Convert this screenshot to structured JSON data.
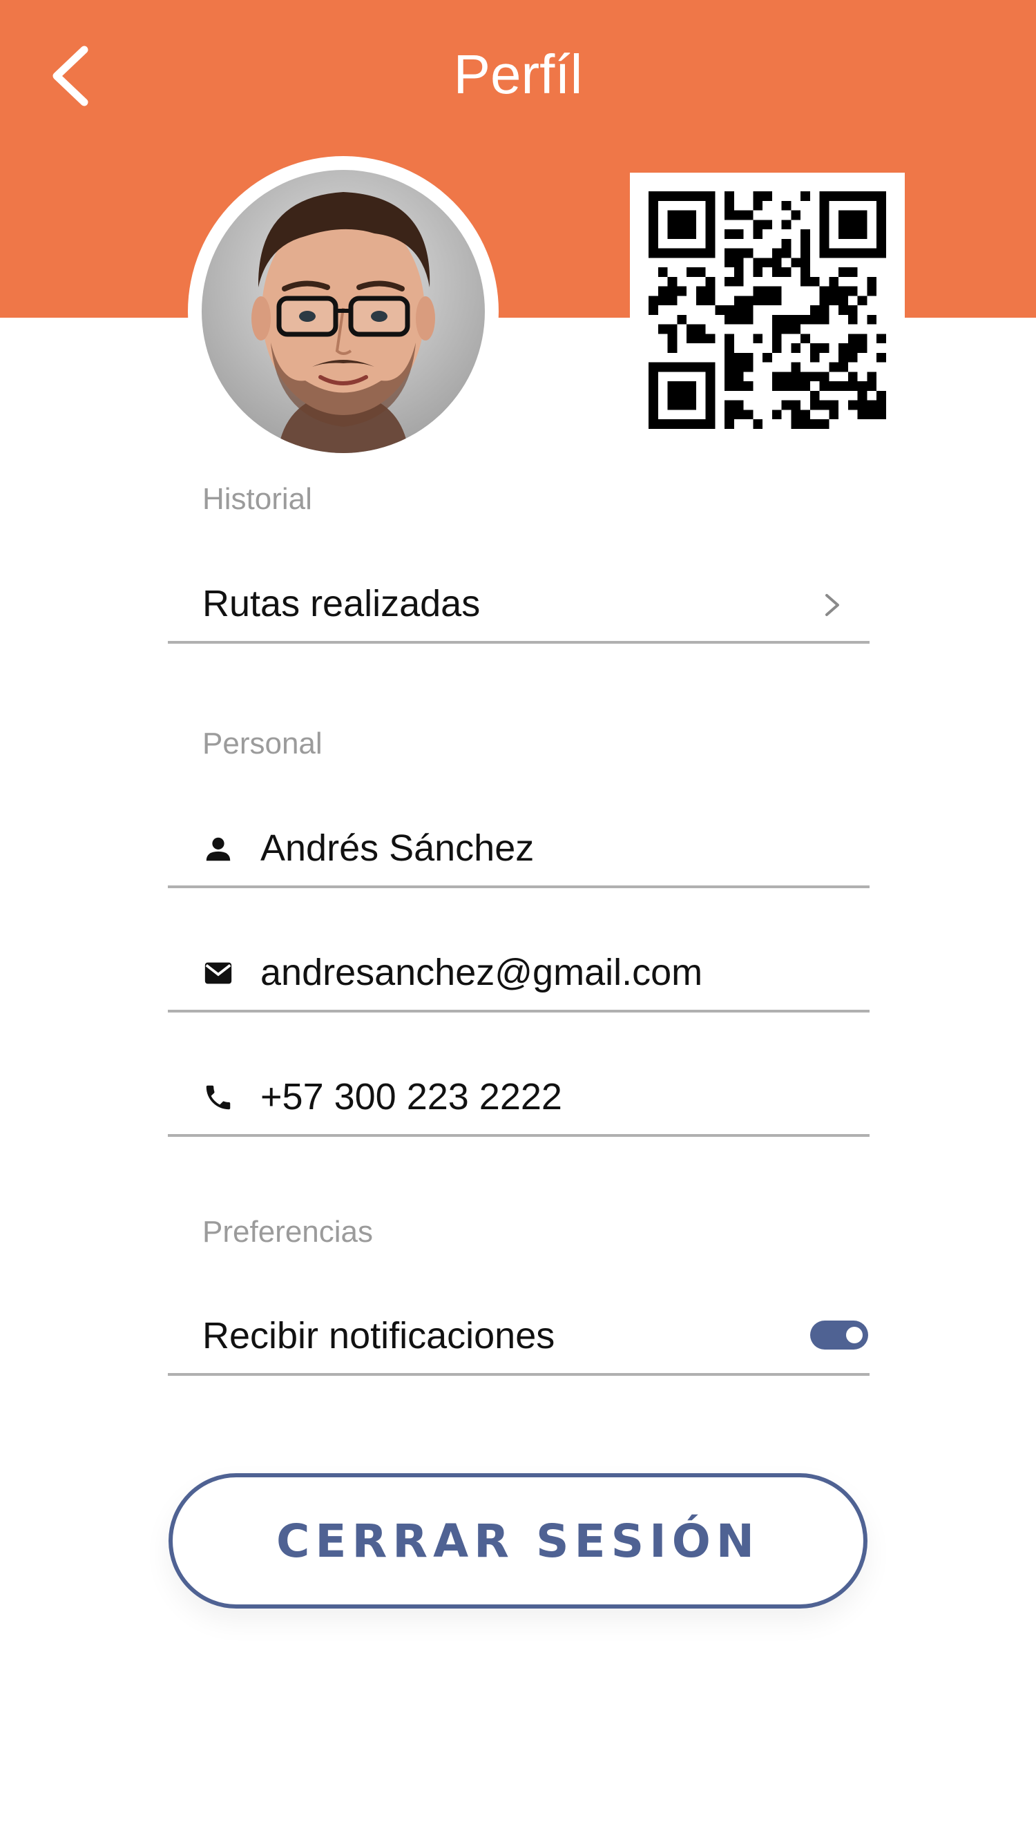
{
  "header": {
    "title": "Perfíl",
    "back_icon": "chevron-left-icon",
    "background_color": "#EF7748"
  },
  "profile": {
    "avatar": "profile-photo",
    "qr_code": "qr-code"
  },
  "history": {
    "section_label": "Historial",
    "routes_label": "Rutas realizadas",
    "routes_icon": "chevron-right-icon"
  },
  "personal": {
    "section_label": "Personal",
    "name": "Andrés Sánchez",
    "name_icon": "person-icon",
    "email": "andresanchez@gmail.com",
    "email_icon": "mail-icon",
    "phone": "+57 300 223 2222",
    "phone_icon": "phone-icon"
  },
  "preferences": {
    "section_label": "Preferencias",
    "notifications_label": "Recibir notificaciones",
    "notifications_enabled": true,
    "toggle_color": "#4F6293"
  },
  "logout": {
    "label": "CERRAR SESIÓN",
    "color": "#4F6293"
  }
}
